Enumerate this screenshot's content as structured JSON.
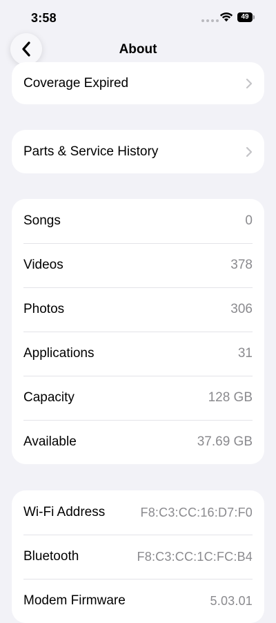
{
  "status": {
    "time": "3:58",
    "battery_level": "49"
  },
  "nav": {
    "title": "About"
  },
  "coverage": {
    "label": "Coverage Expired"
  },
  "parts": {
    "label": "Parts & Service History"
  },
  "media": [
    {
      "label": "Songs",
      "value": "0"
    },
    {
      "label": "Videos",
      "value": "378"
    },
    {
      "label": "Photos",
      "value": "306"
    },
    {
      "label": "Applications",
      "value": "31"
    },
    {
      "label": "Capacity",
      "value": "128 GB"
    },
    {
      "label": "Available",
      "value": "37.69 GB"
    }
  ],
  "network": [
    {
      "label": "Wi-Fi Address",
      "value": "F8:C3:CC:16:D7:F0"
    },
    {
      "label": "Bluetooth",
      "value": "F8:C3:CC:1C:FC:B4"
    },
    {
      "label": "Modem Firmware",
      "value": "5.03.01"
    }
  ],
  "colors": {
    "background": "#f2f2f7",
    "card": "#ffffff",
    "secondary_text": "#8a8a8e",
    "chevron": "#c4c4c7"
  }
}
